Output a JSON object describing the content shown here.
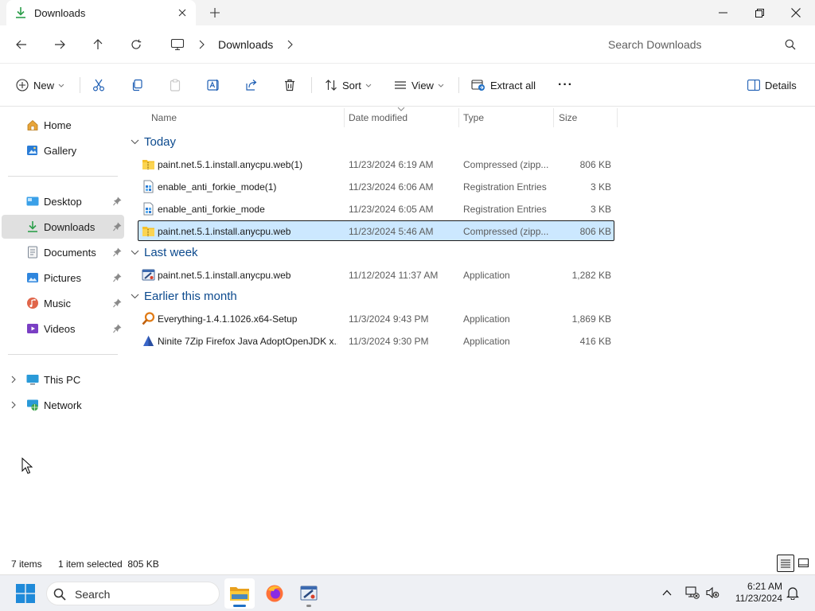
{
  "window": {
    "tab_title": "Downloads",
    "new_tab_glyph": "+",
    "controls": [
      "minimize",
      "maximize",
      "close"
    ]
  },
  "address": {
    "crumb_current": "Downloads",
    "search_placeholder": "Search Downloads"
  },
  "commandbar": {
    "new_label": "New",
    "sort_label": "Sort",
    "view_label": "View",
    "extract_label": "Extract all",
    "more_label": "···",
    "details_label": "Details"
  },
  "sidebar": {
    "items": [
      {
        "label": "Home",
        "icon": "home-icon"
      },
      {
        "label": "Gallery",
        "icon": "gallery-icon"
      },
      {
        "label": "Desktop",
        "icon": "desktop-icon",
        "pinned": true
      },
      {
        "label": "Downloads",
        "icon": "download-icon",
        "pinned": true,
        "selected": true
      },
      {
        "label": "Documents",
        "icon": "documents-icon",
        "pinned": true
      },
      {
        "label": "Pictures",
        "icon": "pictures-icon",
        "pinned": true
      },
      {
        "label": "Music",
        "icon": "music-icon",
        "pinned": true
      },
      {
        "label": "Videos",
        "icon": "videos-icon",
        "pinned": true
      },
      {
        "label": "This PC",
        "icon": "this-pc-icon",
        "expandable": true
      },
      {
        "label": "Network",
        "icon": "network-icon",
        "expandable": true
      }
    ]
  },
  "columns": {
    "name": "Name",
    "date": "Date modified",
    "type": "Type",
    "size": "Size"
  },
  "groups": [
    {
      "label": "Today",
      "files": [
        {
          "name": "paint.net.5.1.install.anycpu.web(1)",
          "date": "11/23/2024 6:19 AM",
          "type": "Compressed (zipp...",
          "size": "806 KB",
          "icon": "zip-folder-icon"
        },
        {
          "name": "enable_anti_forkie_mode(1)",
          "date": "11/23/2024 6:06 AM",
          "type": "Registration Entries",
          "size": "3 KB",
          "icon": "registry-file-icon"
        },
        {
          "name": "enable_anti_forkie_mode",
          "date": "11/23/2024 6:05 AM",
          "type": "Registration Entries",
          "size": "3 KB",
          "icon": "registry-file-icon"
        },
        {
          "name": "paint.net.5.1.install.anycpu.web",
          "date": "11/23/2024 5:46 AM",
          "type": "Compressed (zipp...",
          "size": "806 KB",
          "icon": "zip-folder-icon",
          "selected": true
        }
      ]
    },
    {
      "label": "Last week",
      "files": [
        {
          "name": "paint.net.5.1.install.anycpu.web",
          "date": "11/12/2024 11:37 AM",
          "type": "Application",
          "size": "1,282 KB",
          "icon": "installer-app-icon"
        }
      ]
    },
    {
      "label": "Earlier this month",
      "files": [
        {
          "name": "Everything-1.4.1.1026.x64-Setup",
          "date": "11/3/2024 9:43 PM",
          "type": "Application",
          "size": "1,869 KB",
          "icon": "everything-app-icon"
        },
        {
          "name": "Ninite 7Zip Firefox Java AdoptOpenJDK x...",
          "date": "11/3/2024 9:30 PM",
          "type": "Application",
          "size": "416 KB",
          "icon": "ninite-app-icon"
        }
      ]
    }
  ],
  "status": {
    "item_count": "7 items",
    "selection": "1 item selected  805 KB"
  },
  "taskbar": {
    "search_label": "Search",
    "apps": [
      "file-explorer-icon",
      "firefox-icon",
      "paint-net-installer-icon"
    ]
  },
  "clock": {
    "time": "6:21 AM",
    "date": "11/23/2024"
  },
  "colors": {
    "accent": "#005fb8",
    "selection_bg": "#cce8ff",
    "group_header": "#0c4a8e",
    "sidebar_selected": "#e0e0e0",
    "zip_folder": "#f5c02a"
  }
}
